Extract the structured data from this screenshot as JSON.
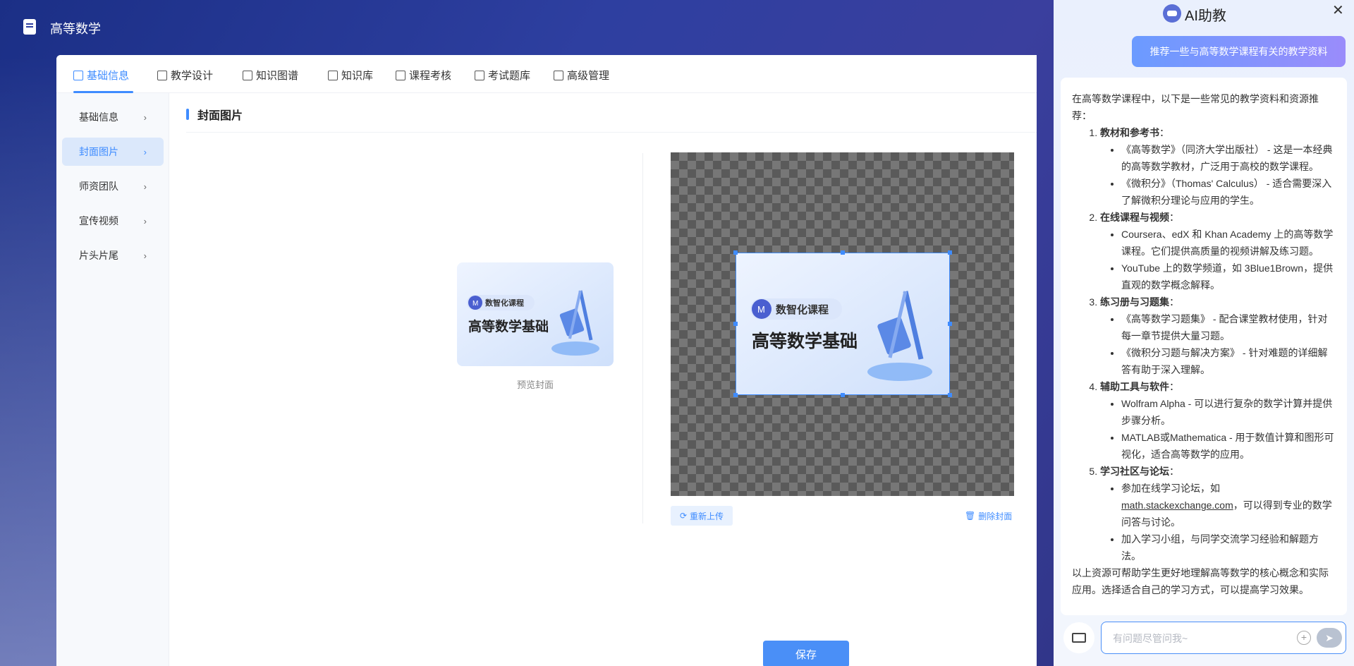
{
  "app": {
    "title": "高等数学"
  },
  "tabs": [
    {
      "label": "基础信息",
      "active": true
    },
    {
      "label": "教学设计"
    },
    {
      "label": "知识图谱"
    },
    {
      "label": "知识库"
    },
    {
      "label": "课程考核"
    },
    {
      "label": "考试题库"
    },
    {
      "label": "高级管理"
    }
  ],
  "subnav": [
    {
      "label": "基础信息"
    },
    {
      "label": "封面图片",
      "active": true
    },
    {
      "label": "师资团队"
    },
    {
      "label": "宣传视频"
    },
    {
      "label": "片头片尾"
    }
  ],
  "section": {
    "title": "封面图片"
  },
  "cover": {
    "badge": "数智化课程",
    "course_title": "高等数学基础",
    "preview_label": "预览封面"
  },
  "actions": {
    "reupload": "重新上传",
    "delete": "删除封面",
    "save": "保存"
  },
  "ai": {
    "title": "AI助教",
    "user_message": "推荐一些与高等数学课程有关的教学资料",
    "answer_intro": "在高等数学课程中，以下是一些常见的教学资料和资源推荐：",
    "sections": [
      {
        "heading": "教材和参考书",
        "items": [
          "《高等数学》（同济大学出版社） - 这是一本经典的高等数学教材，广泛用于高校的数学课程。",
          "《微积分》（Thomas' Calculus） - 适合需要深入了解微积分理论与应用的学生。"
        ]
      },
      {
        "heading": "在线课程与视频",
        "items": [
          "Coursera、edX 和 Khan Academy 上的高等数学课程。它们提供高质量的视频讲解及练习题。",
          "YouTube 上的数学频道，如 3Blue1Brown，提供直观的数学概念解释。"
        ]
      },
      {
        "heading": "练习册与习题集",
        "items": [
          "《高等数学习题集》 - 配合课堂教材使用，针对每一章节提供大量习题。",
          "《微积分习题与解决方案》 - 针对难题的详细解答有助于深入理解。"
        ]
      },
      {
        "heading": "辅助工具与软件",
        "items": [
          "Wolfram Alpha - 可以进行复杂的数学计算并提供步骤分析。",
          "MATLAB或Mathematica - 用于数值计算和图形可视化，适合高等数学的应用。"
        ]
      },
      {
        "heading": "学习社区与论坛",
        "items": [
          "加入学习小组，与同学交流学习经验和解题方法。"
        ]
      }
    ],
    "forum_item": {
      "prefix": "参加在线学习论坛，如 ",
      "link": "math.stackexchange.com",
      "suffix": "，可以得到专业的数学问答与讨论。"
    },
    "answer_outro": "以上资源可帮助学生更好地理解高等数学的核心概念和实际应用。选择适合自己的学习方式，可以提高学习效果。",
    "input_placeholder": "有问题尽管问我~"
  }
}
